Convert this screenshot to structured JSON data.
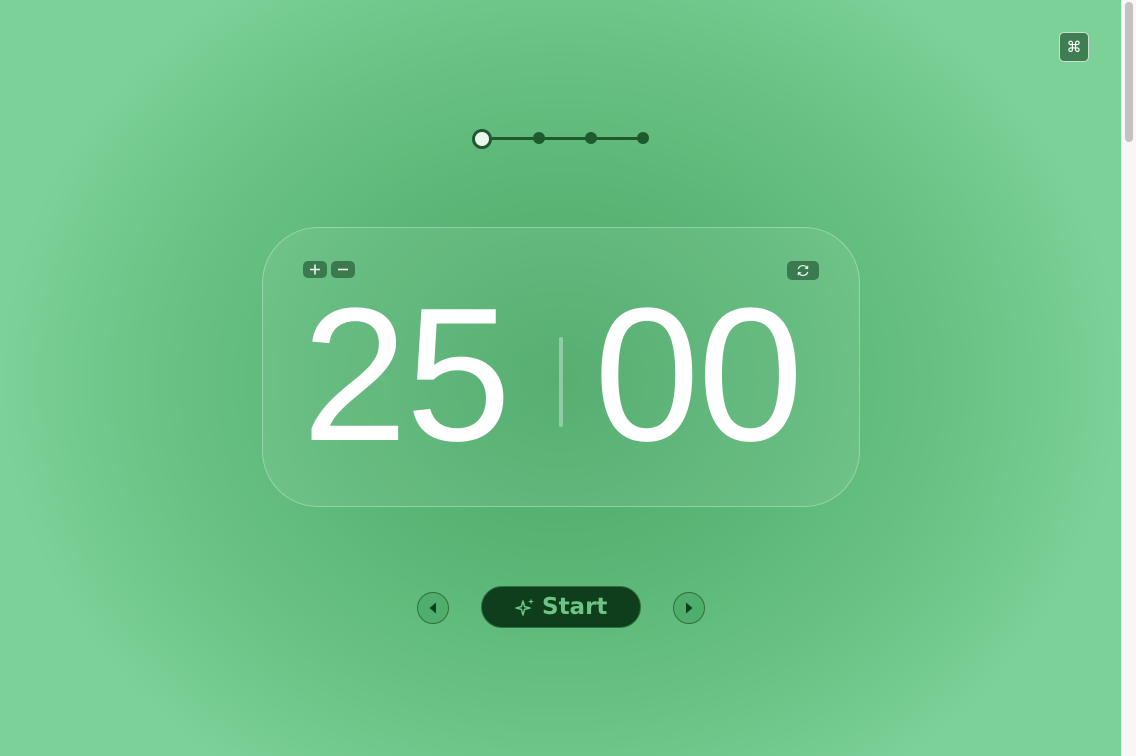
{
  "shortcut_button": {
    "icon": "command-icon",
    "glyph": "⌘"
  },
  "steps": {
    "total": 4,
    "current": 1
  },
  "timer": {
    "minutes": "25",
    "seconds": "00",
    "controls": {
      "increase_icon": "plus-icon",
      "decrease_icon": "minus-icon",
      "reset_icon": "refresh-icon"
    }
  },
  "controls": {
    "start_label": "Start",
    "start_icon": "sparkle-icon",
    "prev_icon": "triangle-left-icon",
    "next_icon": "triangle-right-icon"
  },
  "colors": {
    "accent_dark": "#0f3e1c",
    "accent_green": "#6cc487",
    "step_color": "#1f5a2f",
    "digit_color": "#ffffff"
  }
}
